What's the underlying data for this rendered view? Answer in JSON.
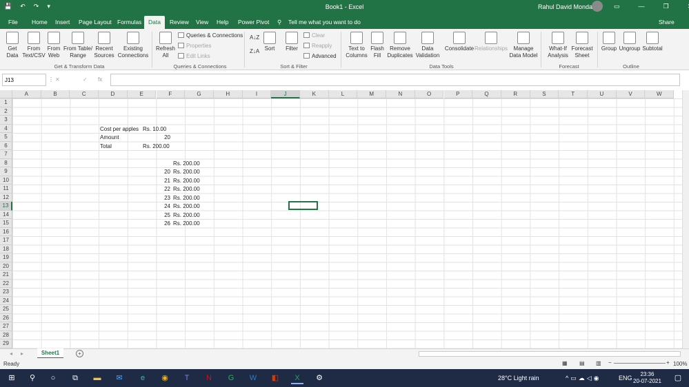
{
  "window": {
    "title": "Book1  -  Excel",
    "user": "Rahul David Mondal"
  },
  "tabs": [
    "File",
    "Home",
    "Insert",
    "Page Layout",
    "Formulas",
    "Data",
    "Review",
    "View",
    "Help",
    "Power Pivot"
  ],
  "active_tab": "Data",
  "tell_me": "Tell me what you want to do",
  "share": "Share",
  "ribbon": {
    "get_data": "Get Data",
    "from_text": "From Text/CSV",
    "from_web": "From Web",
    "from_table": "From Table/ Range",
    "recent_sources": "Recent Sources",
    "existing_connections": "Existing Connections",
    "group_get": "Get & Transform Data",
    "refresh_all": "Refresh All",
    "queries": "Queries & Connections",
    "properties": "Properties",
    "edit_links": "Edit Links",
    "group_queries": "Queries & Connections",
    "sort": "Sort",
    "filter": "Filter",
    "clear": "Clear",
    "reapply": "Reapply",
    "advanced": "Advanced",
    "group_sort": "Sort & Filter",
    "text_to_columns": "Text to Columns",
    "flash_fill": "Flash Fill",
    "remove_duplicates": "Remove Duplicates",
    "data_validation": "Data Validation",
    "consolidate": "Consolidate",
    "relationships": "Relationships",
    "manage_model": "Manage Data Model",
    "group_tools": "Data Tools",
    "what_if": "What-If Analysis",
    "forecast_sheet": "Forecast Sheet",
    "group_forecast": "Forecast",
    "group": "Group",
    "ungroup": "Ungroup",
    "subtotal": "Subtotal",
    "group_outline": "Outline"
  },
  "name_box": "J13",
  "formula": "",
  "columns": [
    "A",
    "B",
    "C",
    "D",
    "E",
    "F",
    "G",
    "H",
    "I",
    "J",
    "K",
    "L",
    "M",
    "N",
    "O",
    "P",
    "Q",
    "R",
    "S",
    "T",
    "U",
    "V",
    "W"
  ],
  "rows": [
    "1",
    "2",
    "3",
    "4",
    "5",
    "6",
    "7",
    "8",
    "9",
    "10",
    "11",
    "12",
    "13",
    "14",
    "15",
    "16",
    "17",
    "18",
    "19",
    "20",
    "21",
    "22",
    "23",
    "24",
    "25",
    "26",
    "27",
    "28",
    "29"
  ],
  "cells": {
    "d4": "Cost per apples",
    "e4": "Rs. 10.00",
    "d5": "Amount",
    "e5": "20",
    "d6": "Total",
    "e6": "Rs. 200.00",
    "f8": "Rs. 200.00",
    "e9": "20",
    "f9": "Rs. 200.00",
    "e10": "21",
    "f10": "Rs. 200.00",
    "e11": "22",
    "f11": "Rs. 200.00",
    "e12": "23",
    "f12": "Rs. 200.00",
    "e13": "24",
    "f13": "Rs. 200.00",
    "e14": "25",
    "f14": "Rs. 200.00",
    "e15": "26",
    "f15": "Rs. 200.00"
  },
  "sheet": "Sheet1",
  "status": "Ready",
  "zoom": "100%",
  "taskbar": {
    "weather": "28°C  Light rain",
    "lang": "ENG",
    "time": "23:36",
    "date": "20-07-2021"
  },
  "colors": {
    "accent": "#217346",
    "taskbar": "#1f2a44"
  }
}
